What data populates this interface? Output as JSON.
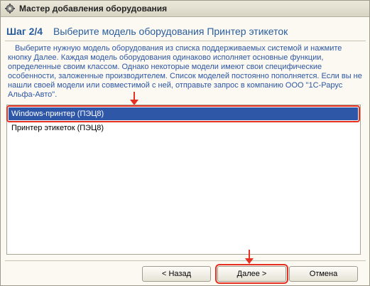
{
  "window": {
    "title": "Мастер добавления оборудования"
  },
  "step": {
    "number": "Шаг 2/4",
    "title": "Выберите модель оборудования Принтер этикеток"
  },
  "description": "Выберите нужную модель оборудования из списка поддерживаемых системой и нажмите кнопку Далее. Каждая модель оборудования одинаково исполняет основные функции, определенные своим классом. Однако некоторые модели имеют свои специфические особенности, заложенные производителем. Список моделей постоянно пополняется. Если вы не нашли своей модели или совместимой с ней, отправьте запрос в компанию ООО \"1С-Рарус Альфа-Авто\".",
  "models": [
    {
      "label": "Windows-принтер (ПЭЦ8)",
      "selected": true
    },
    {
      "label": "Принтер этикеток (ПЭЦ8)",
      "selected": false
    }
  ],
  "buttons": {
    "back": "< Назад",
    "next": "Далее >",
    "cancel": "Отмена"
  },
  "colors": {
    "accent": "#2a5d9e",
    "selection": "#2f57a8",
    "annotation": "#e53022"
  },
  "icons": {
    "title": "gear-icon",
    "annotation": "arrow-down-icon"
  }
}
